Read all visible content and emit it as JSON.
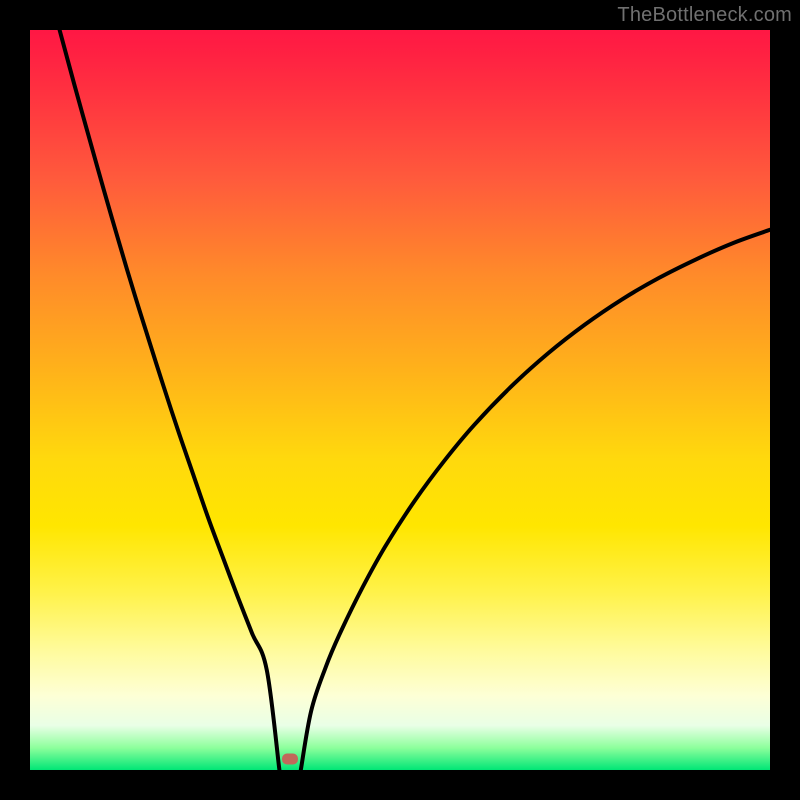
{
  "watermark": "TheBottleneck.com",
  "colors": {
    "frame": "#000000",
    "gradient_top": "#ff1744",
    "gradient_mid": "#ffd90d",
    "gradient_bottom": "#00e676",
    "curve": "#000000",
    "marker": "#c1695a"
  },
  "chart_data": {
    "type": "line",
    "title": "",
    "xlabel": "",
    "ylabel": "",
    "xlim": [
      0,
      100
    ],
    "ylim": [
      0,
      100
    ],
    "grid": false,
    "note": "axes hidden; background is a vertical rainbow gradient (red=top/high, green=bottom/low)",
    "series": [
      {
        "name": "left-branch",
        "x": [
          4.0,
          6.0,
          8.0,
          10.0,
          12.0,
          14.0,
          16.0,
          18.0,
          20.0,
          22.0,
          24.0,
          26.0,
          28.0,
          30.0,
          32.0,
          33.7
        ],
        "values": [
          100.0,
          92.6,
          85.4,
          78.3,
          71.4,
          64.7,
          58.3,
          52.0,
          45.9,
          40.1,
          34.3,
          28.9,
          23.6,
          18.5,
          13.5,
          0.0
        ]
      },
      {
        "name": "right-branch",
        "x": [
          36.6,
          38.0,
          40.0,
          42.0,
          45.0,
          48.0,
          52.0,
          56.0,
          60.0,
          65.0,
          70.0,
          75.0,
          80.0,
          85.0,
          90.0,
          95.0,
          100.0
        ],
        "values": [
          0.0,
          8.0,
          14.0,
          18.7,
          24.8,
          30.2,
          36.4,
          41.8,
          46.6,
          51.8,
          56.3,
          60.2,
          63.6,
          66.5,
          69.0,
          71.2,
          73.0
        ]
      }
    ],
    "marker": {
      "x": 35.1,
      "y": 1.5,
      "shape": "rounded-rect"
    }
  }
}
